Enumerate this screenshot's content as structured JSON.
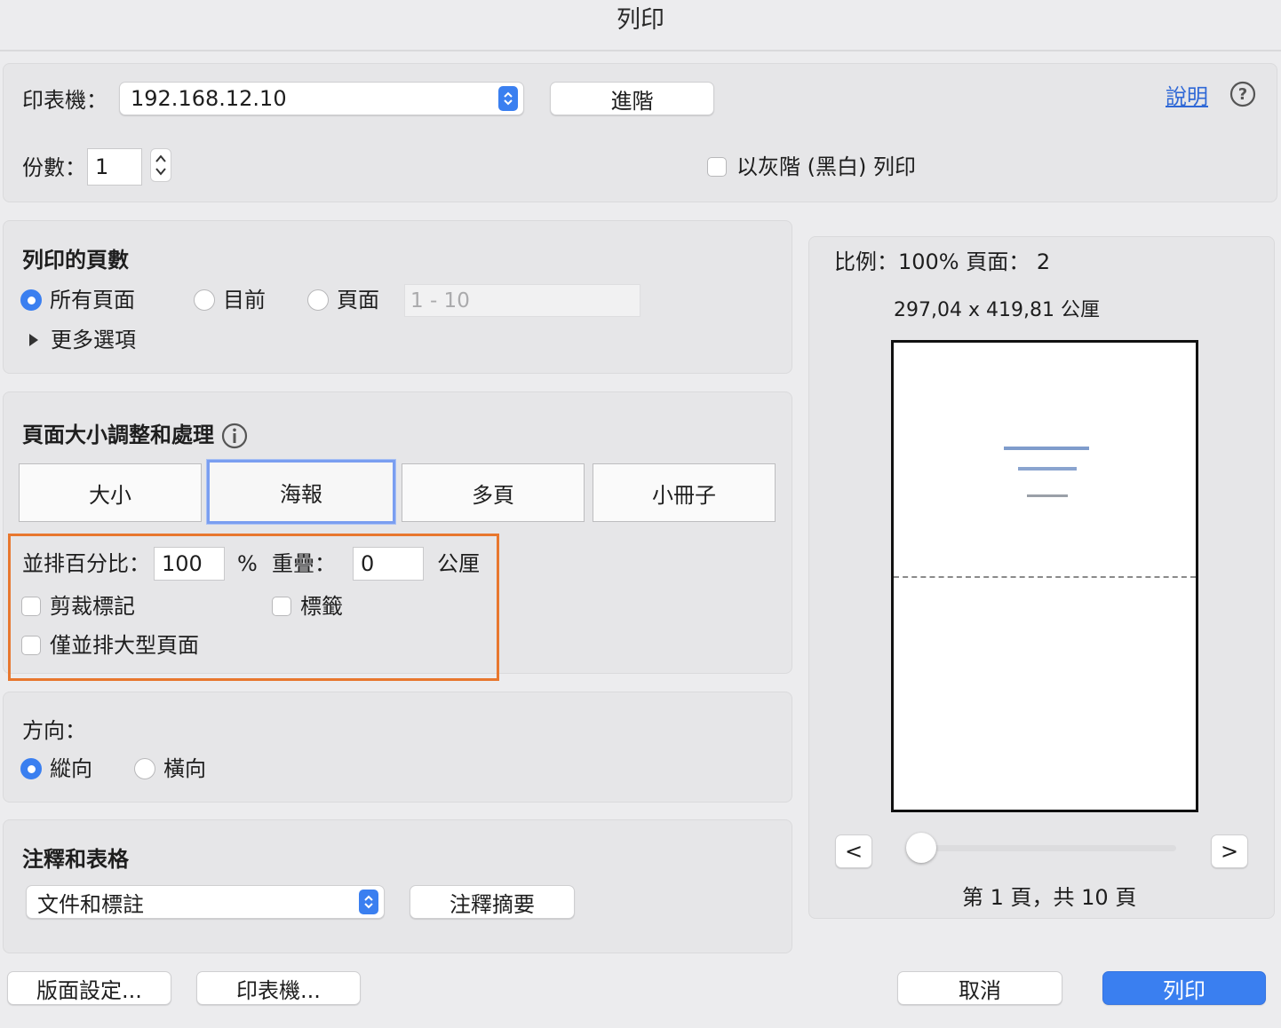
{
  "window": {
    "title": "列印"
  },
  "printer": {
    "label": "印表機：",
    "value": "192.168.12.10",
    "advanced_button": "進階"
  },
  "help": {
    "link": "說明",
    "icon": "help-circle-icon"
  },
  "copies": {
    "label": "份數：",
    "value": "1"
  },
  "grayscale": {
    "label": "以灰階 (黑白) 列印",
    "checked": false
  },
  "pages_to_print": {
    "heading": "列印的頁數",
    "options": [
      "所有頁面",
      "目前",
      "頁面"
    ],
    "selected": "所有頁面",
    "range_placeholder": "1 - 10",
    "more_options": "更多選項"
  },
  "page_sizing": {
    "heading": "頁面大小調整和處理",
    "info_icon": "info-circle-icon",
    "tabs": [
      "大小",
      "海報",
      "多頁",
      "小冊子"
    ],
    "selected_tab": "海報",
    "tile_scale_label": "並排百分比：",
    "tile_scale_value": "100",
    "percent_sign": "%",
    "overlap_label": "重疊：",
    "overlap_value": "0",
    "overlap_unit": "公厘",
    "cut_marks": "剪裁標記",
    "labels": "標籤",
    "tile_large_only": "僅並排大型頁面",
    "highlight_color": "#e8772e"
  },
  "orientation": {
    "heading": "方向：",
    "options": [
      "縱向",
      "橫向"
    ],
    "selected": "縱向"
  },
  "comments_forms": {
    "heading": "注釋和表格",
    "value": "文件和標註",
    "summarize_button": "注釋摘要"
  },
  "preview": {
    "scale_text": "比例：100% 頁面：  2",
    "dimensions": "297,04 x 419,81 公厘",
    "prev_button": "<",
    "next_button": ">",
    "slider_value": 0,
    "page_status": "第 1 頁，共 10 頁"
  },
  "footer": {
    "page_setup": "版面設定...",
    "printer": "印表機...",
    "cancel": "取消",
    "print": "列印",
    "accent_color": "#3a7ff0"
  }
}
